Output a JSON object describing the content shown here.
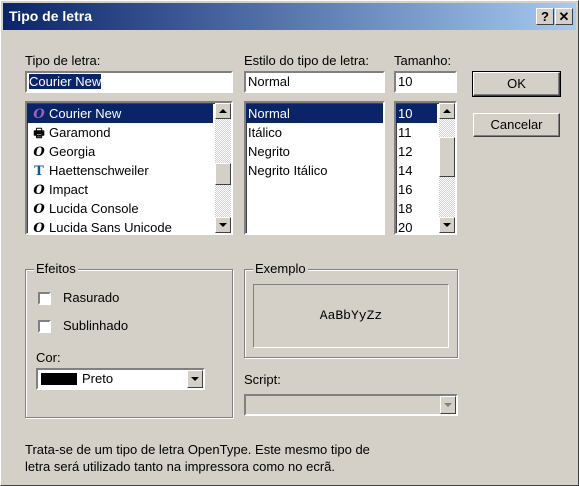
{
  "window": {
    "title": "Tipo de letra",
    "help_glyph": "?",
    "close_glyph": "✕"
  },
  "font": {
    "label": "Tipo de letra:",
    "value": "Courier New",
    "items": [
      {
        "name": "Courier New",
        "icon": "opentype-icon",
        "glyph": "O",
        "selected": true
      },
      {
        "name": "Garamond",
        "icon": "printer-font-icon",
        "glyph": "🖶",
        "selected": false
      },
      {
        "name": "Georgia",
        "icon": "opentype-icon",
        "glyph": "O",
        "selected": false
      },
      {
        "name": "Haettenschweiler",
        "icon": "truetype-icon",
        "glyph": "T",
        "selected": false
      },
      {
        "name": "Impact",
        "icon": "opentype-icon",
        "glyph": "O",
        "selected": false
      },
      {
        "name": "Lucida Console",
        "icon": "opentype-icon",
        "glyph": "O",
        "selected": false
      },
      {
        "name": "Lucida Sans Unicode",
        "icon": "opentype-icon",
        "glyph": "O",
        "selected": false
      }
    ]
  },
  "style": {
    "label": "Estilo do tipo de letra:",
    "value": "Normal",
    "items": [
      "Normal",
      "Itálico",
      "Negrito",
      "Negrito Itálico"
    ],
    "selected_index": 0
  },
  "size": {
    "label": "Tamanho:",
    "value": "10",
    "items": [
      "10",
      "11",
      "12",
      "14",
      "16",
      "18",
      "20"
    ],
    "selected_index": 0
  },
  "buttons": {
    "ok": "OK",
    "cancel": "Cancelar"
  },
  "effects": {
    "title": "Efeitos",
    "strikeout": "Rasurado",
    "underline": "Sublinhado",
    "strikeout_checked": false,
    "underline_checked": false,
    "color_label": "Cor:",
    "color_value": "Preto",
    "color_hex": "#000000"
  },
  "sample": {
    "title": "Exemplo",
    "text": "AaBbYyZz"
  },
  "script": {
    "label": "Script:",
    "value": ""
  },
  "description": "Trata-se de um tipo de letra OpenType. Este mesmo tipo de letra será utilizado tanto na impressora como no ecrã.",
  "description_lines": [
    "Trata-se de um tipo de letra OpenType. Este mesmo tipo de",
    "letra será utilizado tanto na impressora como no ecrã."
  ],
  "colors": {
    "title_bar_start": "#0a246a",
    "title_bar_end": "#a6caf0",
    "selection": "#0a246a",
    "dialog_face": "#d4d0c8",
    "opentype_icon_selected": "#a060c0",
    "truetype_icon": "#0a5a9a"
  }
}
